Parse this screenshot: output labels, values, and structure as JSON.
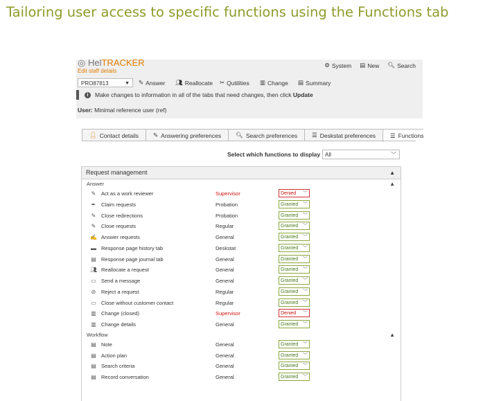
{
  "title": "Tailoring user access to specific functions using the Functions tab",
  "app": {
    "logo_a": "Hel",
    "logo_b": "TRACKER",
    "subtitle": "Edit staff details",
    "nav": {
      "system": "System",
      "new": "New",
      "search": "Search"
    },
    "reference": "PRO87813",
    "toolbar": {
      "answer": "Answer",
      "reallocate": "Reallocate",
      "qutilities": "Qutilities",
      "change": "Change",
      "summary": "Summary"
    },
    "info_text": "Make changes to information in all of the tabs that need changes, then click",
    "info_update": "Update",
    "user_label": "User:",
    "user_value": "Minimal reference user (ref)",
    "tabs": [
      "Contact details",
      "Answering preferences",
      "Search preferences",
      "Deskstat preferences",
      "Functions"
    ],
    "filter_label": "Select which functions to display",
    "filter_value": "All",
    "panel_title": "Request management",
    "answer_section": "Answer",
    "workflow_section": "Workflow",
    "answer_rows": [
      {
        "name": "Act as a work reviewer",
        "level": "Supervisor",
        "perm": "Denied",
        "icon": "pencil-icon"
      },
      {
        "name": "Claim requests",
        "level": "Probation",
        "perm": "Granted",
        "icon": "quill-icon"
      },
      {
        "name": "Close redirections",
        "level": "Probation",
        "perm": "Granted",
        "icon": "pencil-icon"
      },
      {
        "name": "Close requests",
        "level": "Regular",
        "perm": "Granted",
        "icon": "pencil-icon"
      },
      {
        "name": "Answer requests",
        "level": "General",
        "perm": "Granted",
        "icon": "edit-icon"
      },
      {
        "name": "Response page history tab",
        "level": "Deskstat",
        "perm": "Granted",
        "icon": "history-icon"
      },
      {
        "name": "Response page journal tab",
        "level": "General",
        "perm": "Granted",
        "icon": "journal-icon"
      },
      {
        "name": "Reallocate a request",
        "level": "General",
        "perm": "Granted",
        "icon": "people-icon"
      },
      {
        "name": "Send a message",
        "level": "General",
        "perm": "Granted",
        "icon": "message-icon"
      },
      {
        "name": "Reject a request",
        "level": "Regular",
        "perm": "Granted",
        "icon": "reject-icon"
      },
      {
        "name": "Close without customer contact",
        "level": "Regular",
        "perm": "Granted",
        "icon": "folder-icon"
      },
      {
        "name": "Change (closed)",
        "level": "Supervisor",
        "perm": "Denied",
        "icon": "document-icon"
      },
      {
        "name": "Change details",
        "level": "General",
        "perm": "Granted",
        "icon": "document-icon"
      }
    ],
    "workflow_rows": [
      {
        "name": "Note",
        "level": "General",
        "perm": "Granted",
        "icon": "note-icon"
      },
      {
        "name": "Action plan",
        "level": "General",
        "perm": "Granted",
        "icon": "note-icon"
      },
      {
        "name": "Search criteria",
        "level": "General",
        "perm": "Granted",
        "icon": "note-icon"
      },
      {
        "name": "Record conversation",
        "level": "General",
        "perm": "Granted",
        "icon": "note-icon"
      }
    ],
    "colors": {
      "title": "#8f9b2a",
      "brand": "#e07b00",
      "denied": "#d01010",
      "granted": "#4a7a1a"
    }
  }
}
